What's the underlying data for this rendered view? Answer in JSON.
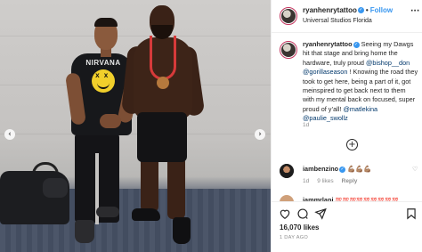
{
  "post": {
    "username": "ryanhenrytattoo",
    "verified": true,
    "follow_label": "Follow",
    "separator": "•",
    "location": "Universal Studios Florida",
    "more_icon": "more-horizontal-icon"
  },
  "photo": {
    "shirt_text": "NIRVANA",
    "prev_icon": "chevron-left-icon",
    "next_icon": "chevron-right-icon"
  },
  "caption": {
    "username": "ryanhenrytattoo",
    "segments": [
      {
        "text": " Seeing my Dawgs hit that stage and bring home the hardware, truly proud ",
        "mention": false
      },
      {
        "text": "@bishop__don",
        "mention": true
      },
      {
        "text": " ",
        "mention": false
      },
      {
        "text": "@gorillaseason",
        "mention": true
      },
      {
        "text": " ! Knowing the road they took to get here, being a part of it, got meinspired to get back next to them with my mental back on focused, super proud of y’all! ",
        "mention": false
      },
      {
        "text": "@matlekina",
        "mention": true
      },
      {
        "text": " ",
        "mention": false
      },
      {
        "text": "@paulie_swollz",
        "mention": true
      }
    ],
    "time": "1d"
  },
  "load_more_icon": "plus-circle-icon",
  "comments": [
    {
      "username": "iambenzino",
      "verified": true,
      "text": "💪🏽💪🏽💪🏽",
      "time": "1d",
      "likes": "9 likes",
      "reply_label": "Reply"
    },
    {
      "username": "iammrlapi",
      "text": "💯💯💯💯💯💯💯💯💯"
    }
  ],
  "actions": {
    "like_icon": "heart-icon",
    "comment_icon": "comment-icon",
    "share_icon": "share-icon",
    "save_icon": "bookmark-icon"
  },
  "likes_count": "16,070 likes",
  "date": "1 DAY AGO",
  "colors": {
    "link_blue": "#3897f0",
    "mention_blue": "#00376b",
    "text": "#262626",
    "muted": "#8e8e8e"
  }
}
